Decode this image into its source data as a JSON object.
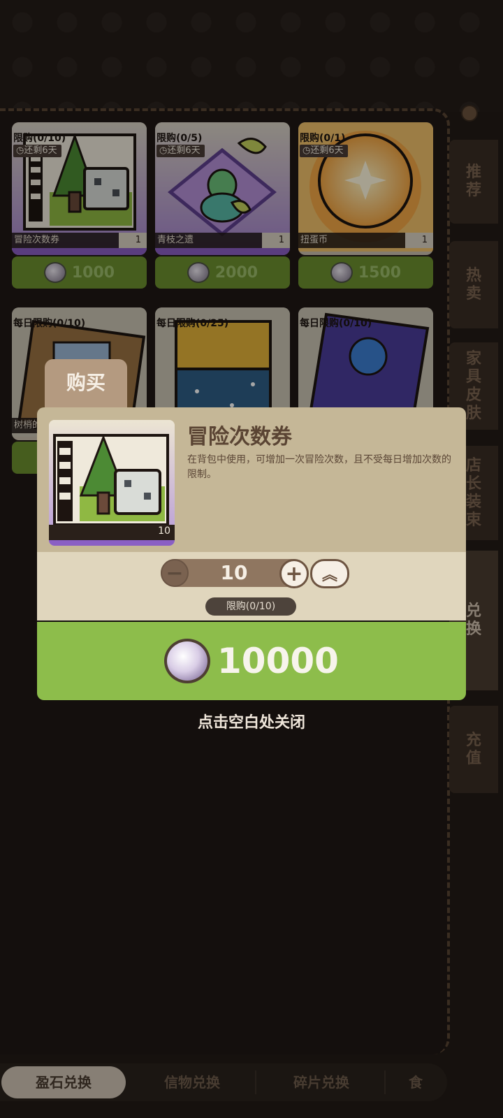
{
  "items": [
    {
      "limit": "限购(0/10)",
      "remain": "还剩6天",
      "name": "冒险次数券",
      "qty": "1",
      "price": "1000"
    },
    {
      "limit": "限购(0/5)",
      "remain": "还剩6天",
      "name": "青枝之遗",
      "qty": "1",
      "price": "2000"
    },
    {
      "limit": "限购(0/1)",
      "remain": "还剩6天",
      "name": "扭蛋币",
      "qty": "1",
      "price": "1500"
    },
    {
      "limit": "每日限购(0/10)",
      "name": "树梢的"
    },
    {
      "limit": "每日限购(0/25)"
    },
    {
      "limit": "每日限购(0/10)"
    }
  ],
  "side_tabs": [
    "推荐",
    "热卖",
    "家具皮肤",
    "店长装束",
    "兑换",
    "充值"
  ],
  "side_active": "兑换",
  "bottom_tabs": [
    "盈石兑换",
    "信物兑换",
    "碎片兑换",
    "食"
  ],
  "modal": {
    "tab_label": "购买",
    "item_name": "冒险次数券",
    "thumb_count": "10",
    "description": "在背包中使用，可增加一次冒险次数，且不受每日增加次数的限制。",
    "quantity": "10",
    "minus": "−",
    "plus": "+",
    "max": "︽",
    "limit": "限购(0/10)",
    "total_price": "10000",
    "close_hint": "点击空白处关闭"
  },
  "colors": {
    "price_green": "#6c8f2e",
    "buy_green": "#8dbd4b",
    "modal_beige": "#c5b797",
    "purple": "#8a5fc4"
  }
}
